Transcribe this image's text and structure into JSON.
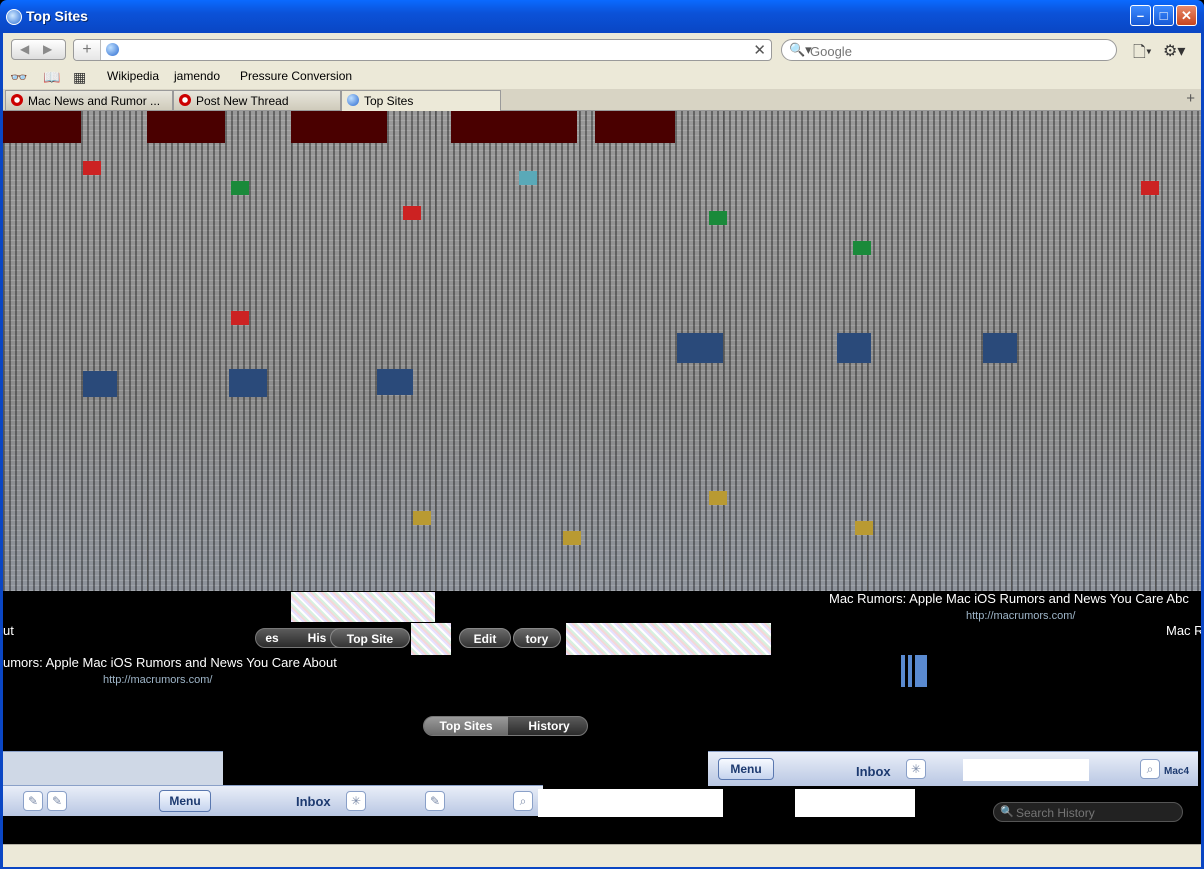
{
  "window": {
    "title": "Top Sites"
  },
  "toolbar": {
    "back_icon": "back-arrow-icon",
    "forward_icon": "forward-arrow-icon",
    "add_bookmark_icon": "plus-icon",
    "address_value": "",
    "clear_icon": "close-icon",
    "search_placeholder": "Google",
    "page_menu_icon": "page-icon",
    "settings_icon": "gear-icon"
  },
  "bookmarks": {
    "icons": [
      "reading-glasses-icon",
      "book-icon",
      "grid-icon"
    ],
    "items": [
      {
        "label": "Wikipedia"
      },
      {
        "label": "jamendo"
      },
      {
        "label": "Pressure Conversion"
      }
    ]
  },
  "tabs": [
    {
      "label": "Mac News and Rumor ...",
      "active": false
    },
    {
      "label": "Post New Thread",
      "active": false
    },
    {
      "label": "Top Sites",
      "active": true
    }
  ],
  "top_sites": {
    "site_title": "Mac Rumors: Apple Mac iOS Rumors and News You Care About",
    "site_title_cut_left": "umors: Apple Mac iOS Rumors and News You Care About",
    "site_title_cut_right": "Mac Rumors: Apple Mac iOS Rumors and News You Care Abc",
    "site_title_fragment_left": "ut",
    "site_title_fragment_right": "Mac R",
    "site_url": "http://macrumors.com/",
    "seg_fragment_1": "es",
    "seg_fragment_2": "His",
    "seg_top_sites": "Top Site",
    "edit_label": "Edit",
    "seg_history_fragment": "tory",
    "main_seg": {
      "top_sites": "Top Sites",
      "history": "History"
    },
    "search_history_placeholder": "Search History"
  },
  "mail": {
    "menu_label": "Menu",
    "inbox_label": "Inbox",
    "mac_label": "Mac4"
  }
}
